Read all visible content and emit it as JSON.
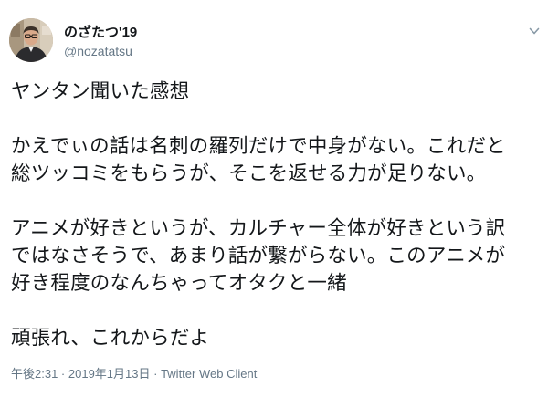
{
  "author": {
    "display_name": "のざたつ'19",
    "handle": "@nozatatsu",
    "avatar_icon": "user-avatar-photo"
  },
  "menu": {
    "icon": "chevron-down-icon"
  },
  "tweet": {
    "lines": [
      "ヤンタン聞いた感想",
      "",
      "かえでぃの話は名刺の羅列だけで中身がない。これだと",
      "総ツッコミをもらうが、そこを返せる力が足りない。",
      "",
      "アニメが好きというが、カルチャー全体が好きという訳",
      "ではなさそうで、あまり話が繋がらない。このアニメが",
      "好き程度のなんちゃってオタクと一緒",
      "",
      "頑張れ、これからだよ"
    ]
  },
  "meta": {
    "time": "午後2:31",
    "separator": " · ",
    "date": "2019年1月13日",
    "client": "Twitter Web Client"
  },
  "colors": {
    "text": "#14171a",
    "secondary": "#657786"
  }
}
